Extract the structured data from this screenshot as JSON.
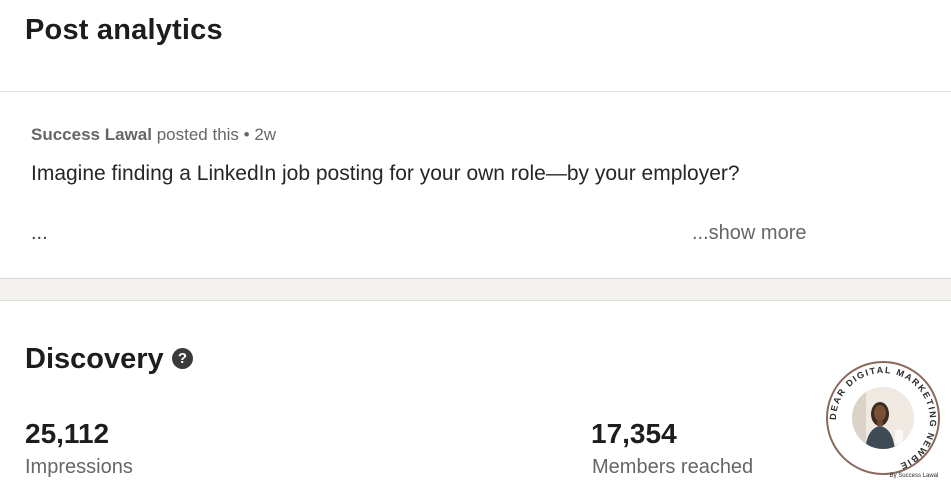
{
  "header": {
    "title": "Post analytics"
  },
  "post": {
    "author": "Success Lawal",
    "meta_suffix": "posted this • 2w",
    "text": "Imagine finding a LinkedIn job posting for your own role—by your employer?",
    "ellipsis": "...",
    "show_more": "...show more"
  },
  "discovery": {
    "title": "Discovery",
    "help_icon": "question-circle-icon",
    "impressions": {
      "value": "25,112",
      "label": "Impressions"
    },
    "members_reached": {
      "value": "17,354",
      "label": "Members reached"
    }
  },
  "watermark": {
    "ring_text": "DEAR DIGITAL MARKETING NEWBIE",
    "byline": "By Success Lawal"
  },
  "colors": {
    "background": "#ffffff",
    "band": "#f3f2ef",
    "text_primary": "#1d1d1d",
    "text_secondary": "#666666",
    "badge_ring": "#8a6a5c"
  }
}
